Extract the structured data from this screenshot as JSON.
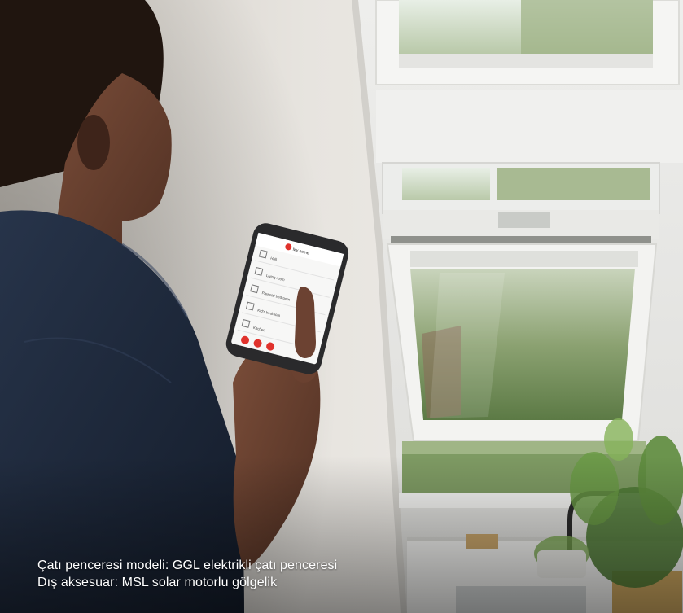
{
  "caption": {
    "line1": "Çatı penceresi modeli: GGL elektrikli çatı penceresi",
    "line2": "Dış aksesuar: MSL solar motorlu gölgelik"
  },
  "phone_app": {
    "header": "My home",
    "rooms": [
      "Hall",
      "Living room",
      "Parents' bedroom",
      "Kid's bedroom",
      "Kitchen"
    ]
  },
  "colors": {
    "wall": "#e9e6e1",
    "window_frame": "#f4f4f2",
    "foliage": "#6e8a55",
    "shirt": "#1f2a3d",
    "skin": "#6b4331",
    "app_accent": "#e0322c",
    "caption_text": "#ffffff"
  }
}
